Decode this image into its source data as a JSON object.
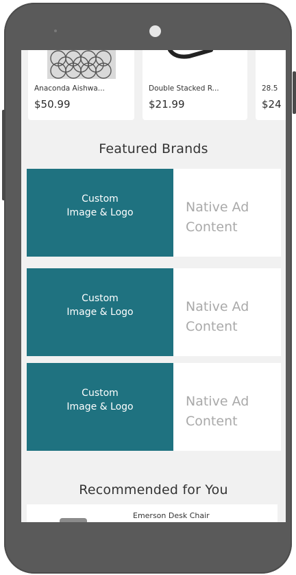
{
  "products": [
    {
      "name": "Anaconda Aishwa...",
      "price": "$50.99",
      "thumb_icon": "lattice-pattern-icon"
    },
    {
      "name": "Double Stacked R...",
      "price": "$21.99",
      "thumb_icon": "black-case-icon"
    },
    {
      "name": "28.5",
      "price": "$24"
    }
  ],
  "featured": {
    "title": "Featured Brands",
    "ads": [
      {
        "image_line1": "Custom",
        "image_line2": "Image & Logo",
        "content_line1": "Native Ad",
        "content_line2": "Content"
      },
      {
        "image_line1": "Custom",
        "image_line2": "Image & Logo",
        "content_line1": "Native Ad",
        "content_line2": "Content"
      },
      {
        "image_line1": "Custom",
        "image_line2": "Image & Logo",
        "content_line1": "Native Ad",
        "content_line2": "Content"
      }
    ]
  },
  "recommended": {
    "title": "Recommended for You",
    "item": {
      "name": "Emerson Desk Chair",
      "thumb_icon": "chair-icon"
    }
  },
  "colors": {
    "ad_image_bg": "#1f7280",
    "frame": "#5a5a5a",
    "screen_bg": "#f1f1f1"
  }
}
